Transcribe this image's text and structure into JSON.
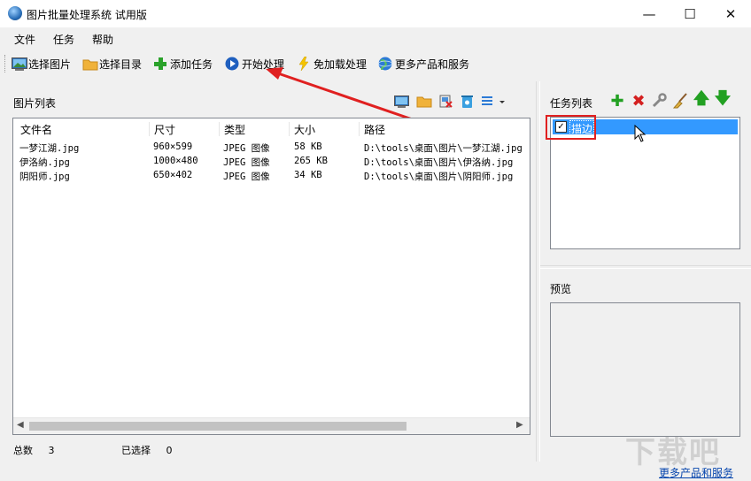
{
  "window": {
    "title": "图片批量处理系统 试用版",
    "controls": {
      "minimize": "—",
      "maximize": "☐",
      "close": "✕"
    }
  },
  "menu": [
    "文件",
    "任务",
    "帮助"
  ],
  "toolbar": [
    {
      "label": "选择图片",
      "icon": "picture-icon"
    },
    {
      "label": "选择目录",
      "icon": "folder-icon"
    },
    {
      "label": "添加任务",
      "icon": "plus-icon"
    },
    {
      "label": "开始处理",
      "icon": "play-icon"
    },
    {
      "label": "免加载处理",
      "icon": "lightning-icon"
    },
    {
      "label": "更多产品和服务",
      "icon": "globe-icon"
    }
  ],
  "image_panel": {
    "title": "图片列表",
    "columns": [
      "文件名",
      "尺寸",
      "类型",
      "大小",
      "路径"
    ],
    "rows": [
      [
        "一梦江湖.jpg",
        "960×599",
        "JPEG 图像",
        "58 KB",
        "D:\\tools\\桌面\\图片\\一梦江湖.jpg"
      ],
      [
        "伊洛纳.jpg",
        "1000×480",
        "JPEG 图像",
        "265 KB",
        "D:\\tools\\桌面\\图片\\伊洛纳.jpg"
      ],
      [
        "阴阳师.jpg",
        "650×402",
        "JPEG 图像",
        "34 KB",
        "D:\\tools\\桌面\\图片\\阴阳师.jpg"
      ]
    ],
    "status": {
      "total_label": "总数",
      "total_value": "3",
      "selected_label": "已选择",
      "selected_value": "0"
    }
  },
  "task_panel": {
    "title": "任务列表",
    "tasks": [
      {
        "name": "描边",
        "checked": true
      }
    ]
  },
  "preview_panel": {
    "title": "预览"
  },
  "footer_link": "更多产品和服务",
  "watermark": "下载吧",
  "colors": {
    "selection": "#3399ff",
    "highlight_box": "#e02020",
    "arrow": "#e02020",
    "link": "#0645ad"
  }
}
